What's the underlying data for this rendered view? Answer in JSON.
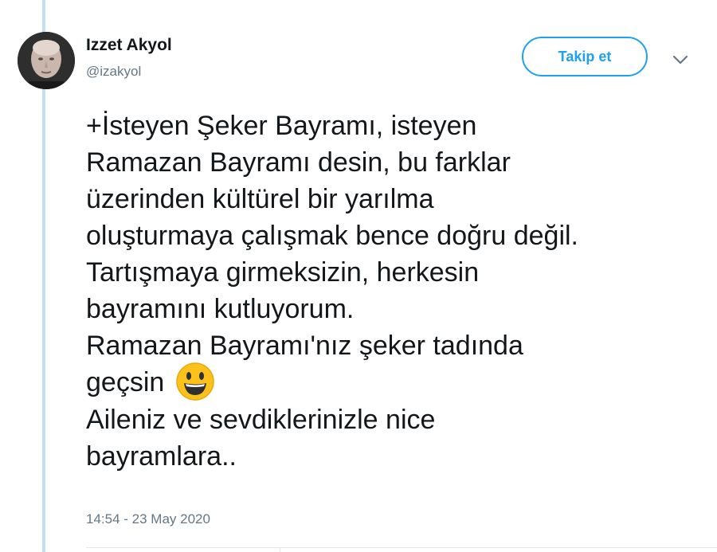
{
  "previous_tweet": {},
  "tweet": {
    "author_name": "Izzet Akyol",
    "author_handle": "@izakyol",
    "follow_label": "Takip et",
    "text_lines": [
      "+İsteyen Şeker Bayramı, isteyen",
      "Ramazan Bayramı desin, bu farklar",
      "üzerinden kültürel bir yarılma",
      "oluşturmaya çalışmak bence doğru değil.",
      "Tartışmaya girmeksizin, herkesin",
      "bayramını kutluyorum.",
      "Ramazan Bayramı'nız şeker tadında",
      "geçsin",
      "Aileniz ve sevdiklerinizle nice",
      "bayramlara.."
    ],
    "emoji": "smiling-face-icon",
    "timestamp": "14:54 - 23 May 2020"
  },
  "colors": {
    "accent": "#1da1f2",
    "thread_line": "#c4dff5",
    "secondary_text": "#657786",
    "primary_text": "#14171a"
  }
}
